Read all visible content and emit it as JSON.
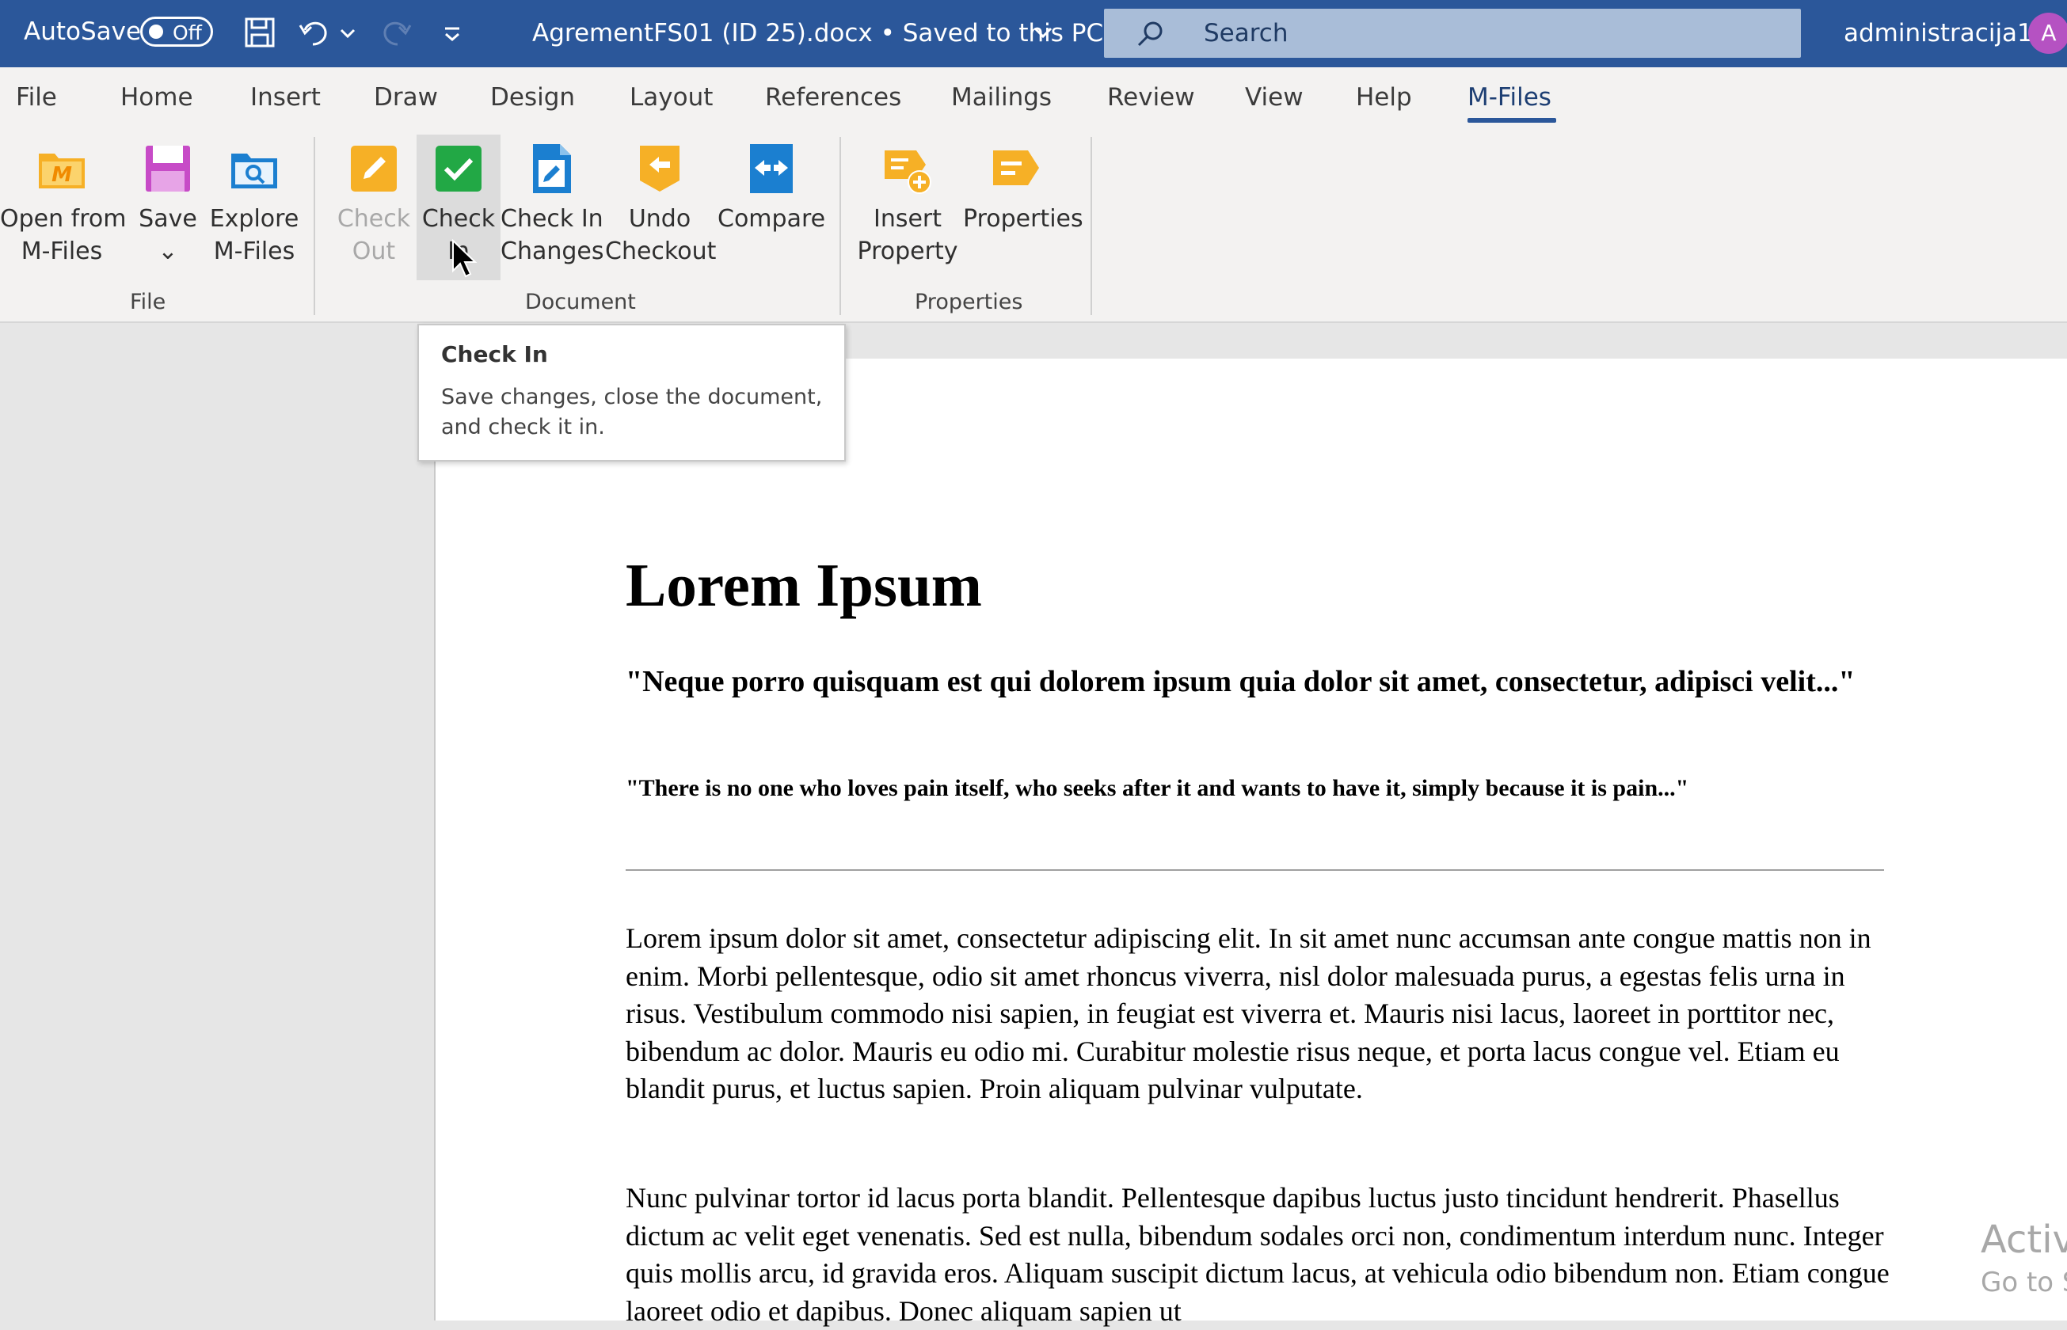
{
  "titlebar": {
    "autosave_label": "AutoSave",
    "autosave_state": "Off",
    "document_title": "AgrementFS01 (ID 25).docx  •  Saved to this PC",
    "search_placeholder": "Search",
    "user_name": "administracija1",
    "avatar_initial": "A"
  },
  "menu": {
    "tabs": [
      "File",
      "Home",
      "Insert",
      "Draw",
      "Design",
      "Layout",
      "References",
      "Mailings",
      "Review",
      "View",
      "Help",
      "M-Files"
    ],
    "active_tab": "M-Files"
  },
  "ribbon": {
    "groups": {
      "file": "File",
      "document": "Document",
      "properties": "Properties"
    },
    "buttons": {
      "open_from_mfiles": {
        "line1": "Open from",
        "line2": "M-Files",
        "icon": "folder-m-icon"
      },
      "save": {
        "line1": "Save",
        "line2": "⌄",
        "icon": "save-icon"
      },
      "explore_mfiles": {
        "line1": "Explore",
        "line2": "M-Files",
        "icon": "explore-folder-icon"
      },
      "check_out": {
        "line1": "Check",
        "line2": "Out",
        "icon": "pencil-icon",
        "disabled": true
      },
      "check_in": {
        "line1": "Check",
        "line2": "In",
        "icon": "checkmark-icon"
      },
      "check_in_changes": {
        "line1": "Check In",
        "line2": "Changes",
        "icon": "document-edit-icon"
      },
      "undo_checkout": {
        "line1": "Undo",
        "line2": "Checkout",
        "icon": "undo-arrow-icon"
      },
      "compare": {
        "line1": "Compare",
        "line2": "",
        "icon": "compare-icon"
      },
      "insert_property": {
        "line1": "Insert",
        "line2": "Property",
        "icon": "insert-property-icon"
      },
      "properties": {
        "line1": "Properties",
        "line2": "",
        "icon": "properties-icon"
      }
    }
  },
  "tooltip": {
    "title": "Check In",
    "body": "Save changes, close the document, and check it in."
  },
  "document": {
    "heading": "Lorem Ipsum",
    "quote1": "\"Neque porro quisquam est qui dolorem ipsum quia dolor sit amet, consectetur, adipisci velit...\"",
    "quote2": "\"There is no one who loves pain itself, who seeks after it and wants to have it, simply because it is pain...\"",
    "paragraph1": "Lorem ipsum dolor sit amet, consectetur adipiscing elit. In sit amet nunc accumsan ante congue mattis non in enim. Morbi pellentesque, odio sit amet rhoncus viverra, nisl dolor malesuada purus, a egestas felis urna in risus. Vestibulum commodo nisi sapien, in feugiat est viverra et. Mauris nisi lacus, laoreet in porttitor nec, bibendum ac dolor. Mauris eu odio mi. Curabitur molestie risus neque, et porta lacus congue vel. Etiam eu blandit purus, et luctus sapien. Proin aliquam pulvinar vulputate.",
    "paragraph2": "Nunc pulvinar tortor id lacus porta blandit. Pellentesque dapibus luctus justo tincidunt hendrerit. Phasellus dictum ac velit eget venenatis. Sed est nulla, bibendum sodales orci non, condimentum interdum nunc. Integer quis mollis arcu, id gravida eros. Aliquam suscipit dictum lacus, at vehicula odio bibendum non. Etiam congue laoreet odio et dapibus. Donec aliquam sapien ut"
  },
  "watermark": {
    "line1": "Activ",
    "line2": "Go to S"
  },
  "colors": {
    "titlebar": "#2b579a",
    "mfiles_yellow": "#f6b026",
    "mfiles_green": "#22a845",
    "mfiles_blue": "#1b7fd0",
    "save_purple": "#c74bc7"
  }
}
